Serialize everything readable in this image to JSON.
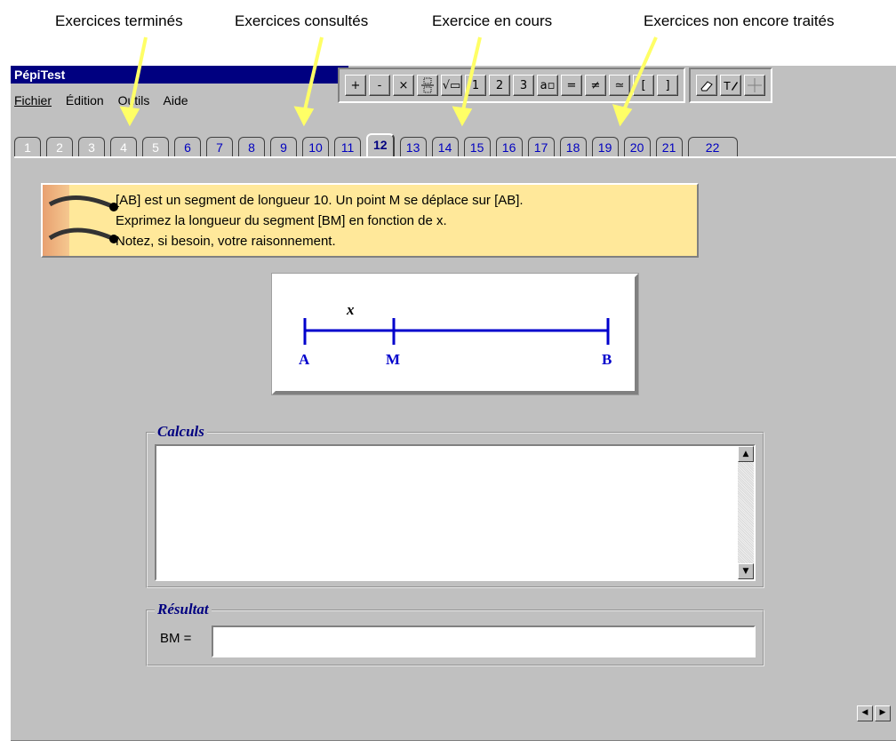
{
  "annotations": [
    {
      "label": "Exercices terminés"
    },
    {
      "label": "Exercices consultés"
    },
    {
      "label": "Exercice en cours"
    },
    {
      "label": "Exercices non encore traités"
    }
  ],
  "app": {
    "title": "PépiTest",
    "menu": [
      "Fichier",
      "Édition",
      "Outils",
      "Aide"
    ]
  },
  "toolbar": {
    "math_buttons": [
      "+",
      "-",
      "×",
      "▭",
      "√▭",
      "1",
      "2",
      "3",
      "a▫",
      "=",
      "≠",
      "≃",
      "[",
      "]"
    ],
    "tool_buttons": [
      "eraser-icon",
      "text-pen-icon",
      "cursor-icon"
    ]
  },
  "tabs": [
    {
      "label": "1",
      "state": "done"
    },
    {
      "label": "2",
      "state": "done"
    },
    {
      "label": "3",
      "state": "done"
    },
    {
      "label": "4",
      "state": "done"
    },
    {
      "label": "5",
      "state": "done"
    },
    {
      "label": "6",
      "state": "consulted"
    },
    {
      "label": "7",
      "state": "consulted"
    },
    {
      "label": "8",
      "state": "consulted"
    },
    {
      "label": "9",
      "state": "consulted"
    },
    {
      "label": "10",
      "state": "consulted"
    },
    {
      "label": "11",
      "state": "consulted"
    },
    {
      "label": "12",
      "state": "current"
    },
    {
      "label": "13",
      "state": "todo"
    },
    {
      "label": "14",
      "state": "todo"
    },
    {
      "label": "15",
      "state": "todo"
    },
    {
      "label": "16",
      "state": "todo"
    },
    {
      "label": "17",
      "state": "todo"
    },
    {
      "label": "18",
      "state": "todo"
    },
    {
      "label": "19",
      "state": "todo"
    },
    {
      "label": "20",
      "state": "todo"
    },
    {
      "label": "21",
      "state": "todo"
    },
    {
      "label": "22",
      "state": "todo"
    }
  ],
  "statement": {
    "lines": [
      "[AB] est un segment de longueur 10. Un point M se déplace sur [AB].",
      "Exprimez la longueur du segment [BM] en fonction de x.",
      "Notez, si besoin, votre raisonnement."
    ]
  },
  "figure": {
    "var_label": "x",
    "point_a": "A",
    "point_m": "M",
    "point_b": "B",
    "line_color": "#0000cc"
  },
  "calculs": {
    "legend": "Calculs",
    "value": ""
  },
  "resultat": {
    "legend": "Résultat",
    "label": "BM =",
    "value": ""
  },
  "colors": {
    "arrow": "#ffff66",
    "tab_todo": "#0000c0",
    "legend": "#000080"
  }
}
